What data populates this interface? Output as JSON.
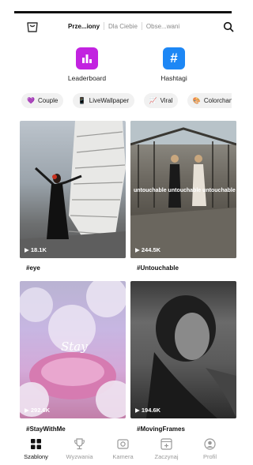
{
  "header": {
    "tabs": [
      {
        "label": "Prze...iony",
        "active": true
      },
      {
        "label": "Dla Ciebie",
        "active": false
      },
      {
        "label": "Obse...wani",
        "active": false
      }
    ]
  },
  "quick_links": [
    {
      "label": "Leaderboard",
      "icon": "bar-chart-icon",
      "color": "#c223e0"
    },
    {
      "label": "Hashtagi",
      "icon": "hashtag-icon",
      "color": "#1d87f5",
      "glyph": "#"
    }
  ],
  "chips": [
    {
      "label": "Couple",
      "icon": "purple-heart-icon",
      "glyph": "💜"
    },
    {
      "label": "LiveWallpaper",
      "icon": "phone-icon",
      "glyph": "📱"
    },
    {
      "label": "Viral",
      "icon": "rising-chart-icon",
      "glyph": "📈"
    },
    {
      "label": "Colorchange",
      "icon": "palette-icon",
      "glyph": "🎨"
    }
  ],
  "cards": [
    {
      "views": "▶ 18.1K",
      "caption": "#eye"
    },
    {
      "views": "▶ 244.5K",
      "caption": "#Untouchable",
      "overlay_text": "untouchable untouchable untouchable"
    },
    {
      "views": "▶ 292.6K",
      "caption": "#StayWithMe",
      "overlay_text": "Stay"
    },
    {
      "views": "▶ 194.6K",
      "caption": "#MovingFrames"
    }
  ],
  "bottom_nav": [
    {
      "label": "Szablony",
      "icon": "grid-icon",
      "active": true
    },
    {
      "label": "Wyzwania",
      "icon": "trophy-icon",
      "active": false
    },
    {
      "label": "Kamera",
      "icon": "camera-icon",
      "active": false
    },
    {
      "label": "Zaczynaj",
      "icon": "add-frame-icon",
      "active": false
    },
    {
      "label": "Profil",
      "icon": "profile-icon",
      "active": false
    }
  ]
}
